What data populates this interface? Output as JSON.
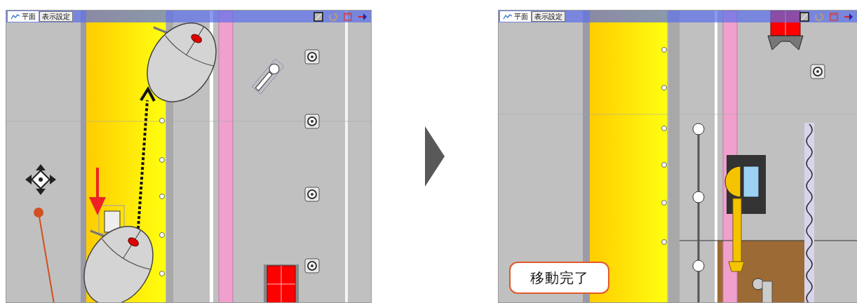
{
  "panels": [
    {
      "kind": "before",
      "tabs": [
        {
          "label": "平面",
          "selected": true
        },
        {
          "label": "表示設定",
          "selected": false
        }
      ]
    },
    {
      "kind": "after",
      "tabs": [
        {
          "label": "平面",
          "selected": true
        },
        {
          "label": "表示設定",
          "selected": false
        }
      ],
      "callout": "移動完了"
    }
  ]
}
